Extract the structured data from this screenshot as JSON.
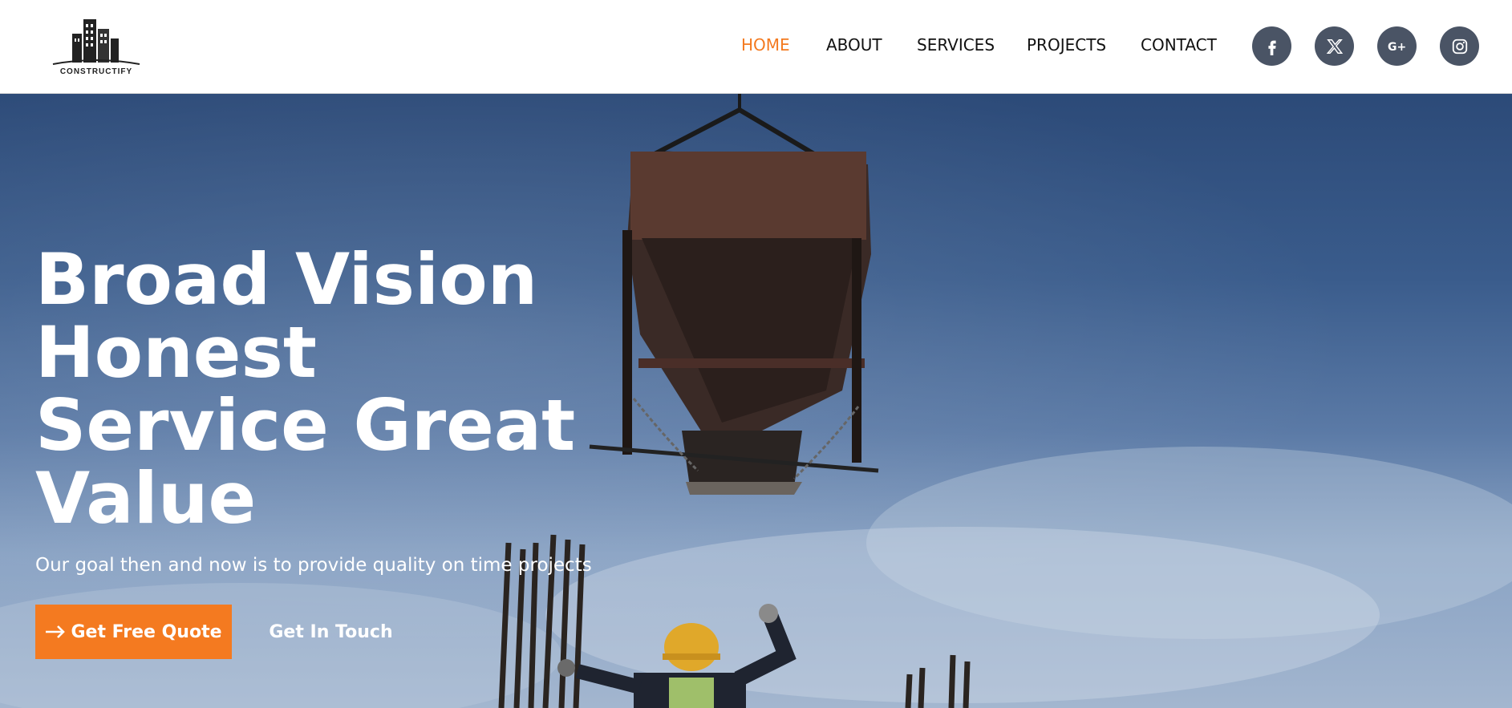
{
  "brand": {
    "logo_text": "CONSTRUCTIFY"
  },
  "nav": {
    "items": [
      {
        "label": "HOME",
        "active": true
      },
      {
        "label": "ABOUT",
        "active": false
      },
      {
        "label": "SERVICES",
        "active": false
      },
      {
        "label": "PROJECTS",
        "active": false
      },
      {
        "label": "CONTACT",
        "active": false
      }
    ]
  },
  "social": [
    {
      "icon": "facebook-icon"
    },
    {
      "icon": "x-twitter-icon"
    },
    {
      "icon": "google-plus-icon"
    },
    {
      "icon": "instagram-icon"
    }
  ],
  "hero": {
    "headline_lines": [
      "Broad Vision",
      "Honest",
      "Service Great",
      "Value"
    ],
    "subtext": "Our goal then and now is to provide quality on time projects",
    "primary_button": "Get Free Quote",
    "secondary_button": "Get In Touch"
  },
  "colors": {
    "accent": "#f47a20",
    "social_bg": "#4a5465",
    "nav_text": "#111111"
  }
}
